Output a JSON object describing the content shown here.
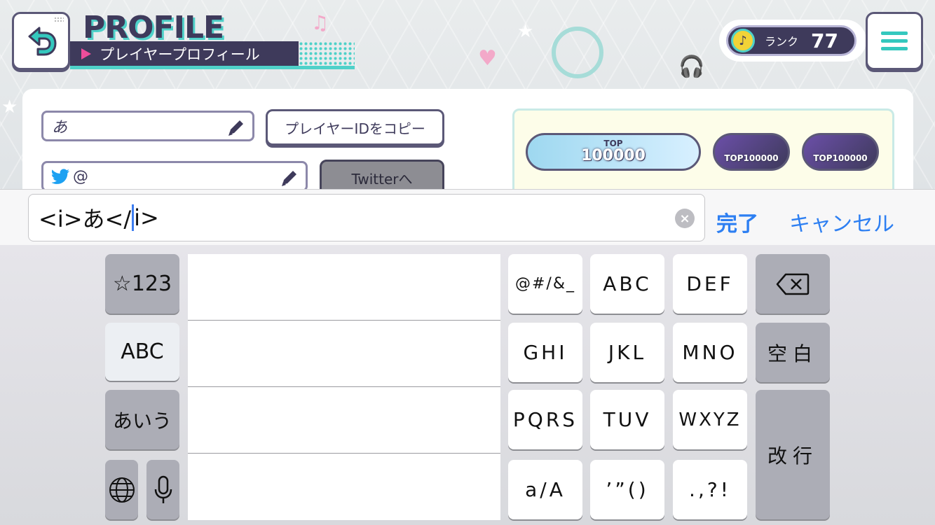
{
  "header": {
    "title": "PROFILE",
    "subtitle": "プレイヤープロフィール",
    "rank_label": "ランク",
    "rank_value": "77"
  },
  "profile": {
    "name_value": "あ",
    "twitter_value": "@",
    "copy_id_label": "プレイヤーIDをコピー",
    "twitter_button_label": "Twitterへ",
    "badges": [
      {
        "top": "TOP",
        "value": "100000"
      },
      {
        "value": "TOP100000"
      },
      {
        "value": "TOP100000"
      }
    ]
  },
  "input_bar": {
    "text_before_caret": "<i>あ</",
    "text_after_caret": "i>",
    "done_label": "完了",
    "cancel_label": "キャンセル"
  },
  "keyboard": {
    "mode_keys": [
      "☆123",
      "ABC",
      "あいう"
    ],
    "keys": [
      [
        "@#/&_",
        "ABC",
        "DEF"
      ],
      [
        "GHI",
        "JKL",
        "MNO"
      ],
      [
        "PQRS",
        "TUV",
        "WXYZ"
      ],
      [
        "a/A",
        "’”()",
        ".,?!"
      ]
    ],
    "space_label": "空白",
    "return_label": "改行"
  },
  "colors": {
    "accent_teal": "#4fd1c9",
    "navy": "#3e3a5b",
    "pink": "#ee4d9b",
    "ios_blue": "#2d7ff2"
  }
}
